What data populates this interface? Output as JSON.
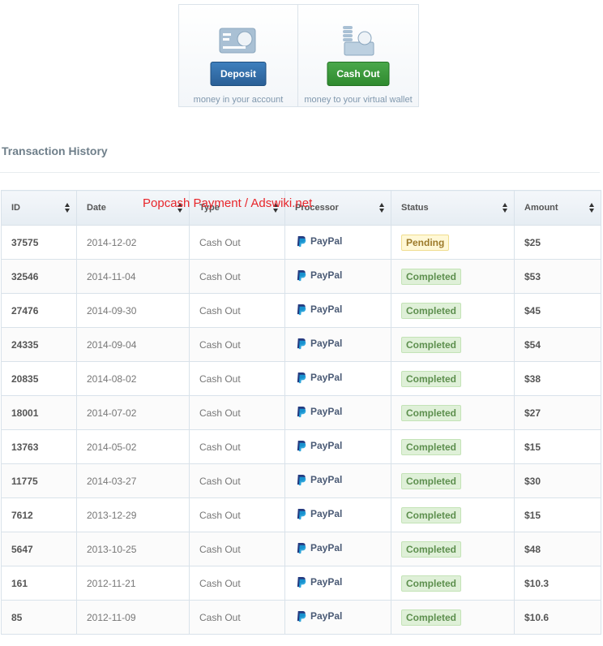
{
  "actions": {
    "deposit": {
      "label": "Deposit",
      "note": "money in your account",
      "icon": "credit-card-icon"
    },
    "cashout": {
      "label": "Cash Out",
      "note": "money to your virtual wallet",
      "icon": "coins-wallet-icon"
    }
  },
  "section_title": "Transaction History",
  "watermark": "Popcash Payment  / Adswiki.net",
  "table": {
    "headers": [
      "ID",
      "Date",
      "Type",
      "Processor",
      "Status",
      "Amount"
    ],
    "rows": [
      {
        "id": "37575",
        "date": "2014-12-02",
        "type": "Cash Out",
        "processor": "PayPal",
        "status": "Pending",
        "amount": "$25"
      },
      {
        "id": "32546",
        "date": "2014-11-04",
        "type": "Cash Out",
        "processor": "PayPal",
        "status": "Completed",
        "amount": "$53"
      },
      {
        "id": "27476",
        "date": "2014-09-30",
        "type": "Cash Out",
        "processor": "PayPal",
        "status": "Completed",
        "amount": "$45"
      },
      {
        "id": "24335",
        "date": "2014-09-04",
        "type": "Cash Out",
        "processor": "PayPal",
        "status": "Completed",
        "amount": "$54"
      },
      {
        "id": "20835",
        "date": "2014-08-02",
        "type": "Cash Out",
        "processor": "PayPal",
        "status": "Completed",
        "amount": "$38"
      },
      {
        "id": "18001",
        "date": "2014-07-02",
        "type": "Cash Out",
        "processor": "PayPal",
        "status": "Completed",
        "amount": "$27"
      },
      {
        "id": "13763",
        "date": "2014-05-02",
        "type": "Cash Out",
        "processor": "PayPal",
        "status": "Completed",
        "amount": "$15"
      },
      {
        "id": "11775",
        "date": "2014-03-27",
        "type": "Cash Out",
        "processor": "PayPal",
        "status": "Completed",
        "amount": "$30"
      },
      {
        "id": "7612",
        "date": "2013-12-29",
        "type": "Cash Out",
        "processor": "PayPal",
        "status": "Completed",
        "amount": "$15"
      },
      {
        "id": "5647",
        "date": "2013-10-25",
        "type": "Cash Out",
        "processor": "PayPal",
        "status": "Completed",
        "amount": "$48"
      },
      {
        "id": "161",
        "date": "2012-11-21",
        "type": "Cash Out",
        "processor": "PayPal",
        "status": "Completed",
        "amount": "$10.3"
      },
      {
        "id": "85",
        "date": "2012-11-09",
        "type": "Cash Out",
        "processor": "PayPal",
        "status": "Completed",
        "amount": "$10.6"
      }
    ]
  },
  "colors": {
    "deposit_button": "#2f6aa5",
    "cashout_button": "#3a983a",
    "completed_badge": "#dff0d8",
    "pending_badge": "#fff8d6",
    "paypal": "#253b80",
    "watermark": "#e8252a"
  }
}
